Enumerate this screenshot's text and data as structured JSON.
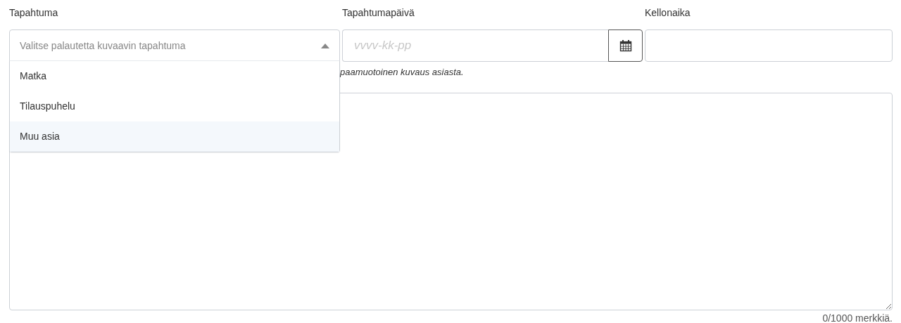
{
  "event_field": {
    "label": "Tapahtuma",
    "placeholder": "Valitse palautetta kuvaavin tapahtuma",
    "expanded": true,
    "options": [
      {
        "label": "Matka",
        "selected": false
      },
      {
        "label": "Tilauspuhelu",
        "selected": false
      },
      {
        "label": "Muu asia",
        "selected": true
      }
    ]
  },
  "date_field": {
    "label": "Tapahtumapäivä",
    "placeholder": "vvvv-kk-pp"
  },
  "time_field": {
    "label": "Kellonaika"
  },
  "description_hint": "paamuotoinen kuvaus asiasta.",
  "character_counter": "0/1000 merkkiä."
}
